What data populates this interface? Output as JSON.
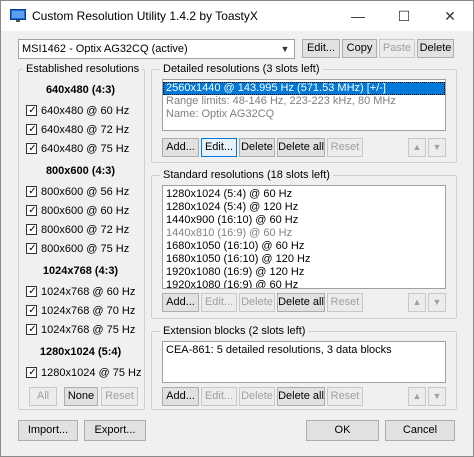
{
  "titlebar": {
    "title": "Custom Resolution Utility 1.4.2 by ToastyX",
    "minimize": "—",
    "maximize": "☐",
    "close": "✕"
  },
  "monitor": {
    "selected": "MSI1462 - Optix AG32CQ (active)",
    "arrow": "▼",
    "buttons": {
      "edit": "Edit...",
      "copy": "Copy",
      "paste": "Paste",
      "delete": "Delete"
    }
  },
  "established": {
    "label": "Established resolutions",
    "groups": [
      {
        "title": "640x480 (4:3)",
        "items": [
          "640x480 @ 60 Hz",
          "640x480 @ 72 Hz",
          "640x480 @ 75 Hz"
        ]
      },
      {
        "title": "800x600 (4:3)",
        "items": [
          "800x600 @ 56 Hz",
          "800x600 @ 60 Hz",
          "800x600 @ 72 Hz",
          "800x600 @ 75 Hz"
        ]
      },
      {
        "title": "1024x768 (4:3)",
        "items": [
          "1024x768 @ 60 Hz",
          "1024x768 @ 70 Hz",
          "1024x768 @ 75 Hz"
        ]
      },
      {
        "title": "1280x1024 (5:4)",
        "items": [
          "1280x1024 @ 75 Hz"
        ]
      }
    ],
    "buttons": {
      "all": "All",
      "none": "None",
      "reset": "Reset"
    }
  },
  "detailed": {
    "label": "Detailed resolutions (3 slots left)",
    "items": [
      "2560x1440 @ 143.995 Hz (571.53 MHz) [+/-]",
      "Range limits: 48-146 Hz, 223-223 kHz, 80 MHz",
      "Name: Optix AG32CQ"
    ],
    "buttons": {
      "add": "Add...",
      "edit": "Edit...",
      "delete": "Delete",
      "delete_all": "Delete all",
      "reset": "Reset"
    }
  },
  "standard": {
    "label": "Standard resolutions (18 slots left)",
    "items": [
      "1280x1024 (5:4) @ 60 Hz",
      "1280x1024 (5:4) @ 120 Hz",
      "1440x900 (16:10) @ 60 Hz",
      "1440x810 (16:9) @ 60 Hz",
      "1680x1050 (16:10) @ 60 Hz",
      "1680x1050 (16:10) @ 120 Hz",
      "1920x1080 (16:9) @ 120 Hz",
      "1920x1080 (16:9) @ 60 Hz"
    ],
    "buttons": {
      "add": "Add...",
      "edit": "Edit...",
      "delete": "Delete",
      "delete_all": "Delete all",
      "reset": "Reset"
    }
  },
  "extension": {
    "label": "Extension blocks (2 slots left)",
    "items": [
      "CEA-861: 5 detailed resolutions, 3 data blocks"
    ],
    "buttons": {
      "add": "Add...",
      "edit": "Edit...",
      "delete": "Delete",
      "delete_all": "Delete all",
      "reset": "Reset"
    }
  },
  "arrows": {
    "up": "▲",
    "down": "▼"
  },
  "footer": {
    "import": "Import...",
    "export": "Export...",
    "ok": "OK",
    "cancel": "Cancel"
  },
  "checkmark": "✓"
}
